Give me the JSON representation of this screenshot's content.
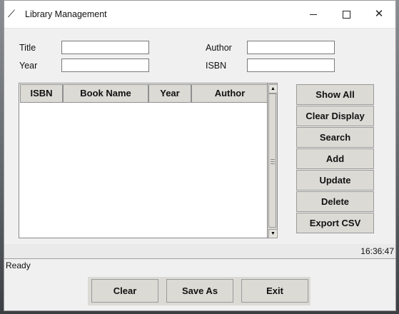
{
  "window": {
    "title": "Library Management",
    "icon": "feather-icon",
    "controls": {
      "minimize": "minimize-icon",
      "maximize": "maximize-icon",
      "close": "close-icon"
    }
  },
  "form": {
    "title_label": "Title",
    "year_label": "Year",
    "author_label": "Author",
    "isbn_label": "ISBN",
    "title_value": "",
    "year_value": "",
    "author_value": "",
    "isbn_value": ""
  },
  "table": {
    "columns": [
      "ISBN",
      "Book Name",
      "Year",
      "Author"
    ],
    "rows": []
  },
  "actions": [
    "Show All",
    "Clear Display",
    "Search",
    "Add",
    "Update",
    "Delete",
    "Export CSV"
  ],
  "clock": "16:36:47",
  "status": "Ready",
  "bottom_buttons": [
    "Clear",
    "Save As",
    "Exit"
  ]
}
